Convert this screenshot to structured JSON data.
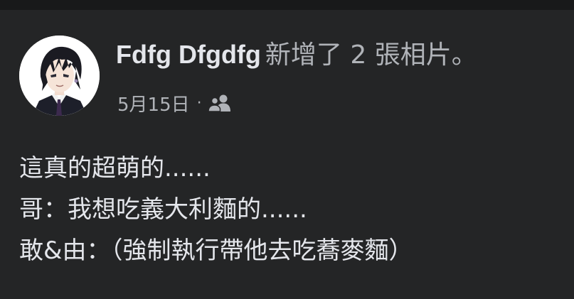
{
  "post": {
    "author": "Fdfg Dfgdfg",
    "action": "新增了 2 張相片。",
    "date": "5月15日",
    "separator": "·",
    "audience_icon": "friends-icon",
    "text_lines": [
      "這真的超萌的......",
      "哥：我想吃義大利麵的......",
      "敢&由：（強制執行帶他去吃蕎麥麵）"
    ]
  },
  "colors": {
    "background": "#242526",
    "top_strip": "#18191a",
    "primary_text": "#e4e6eb",
    "secondary_text": "#b0b3b8"
  }
}
